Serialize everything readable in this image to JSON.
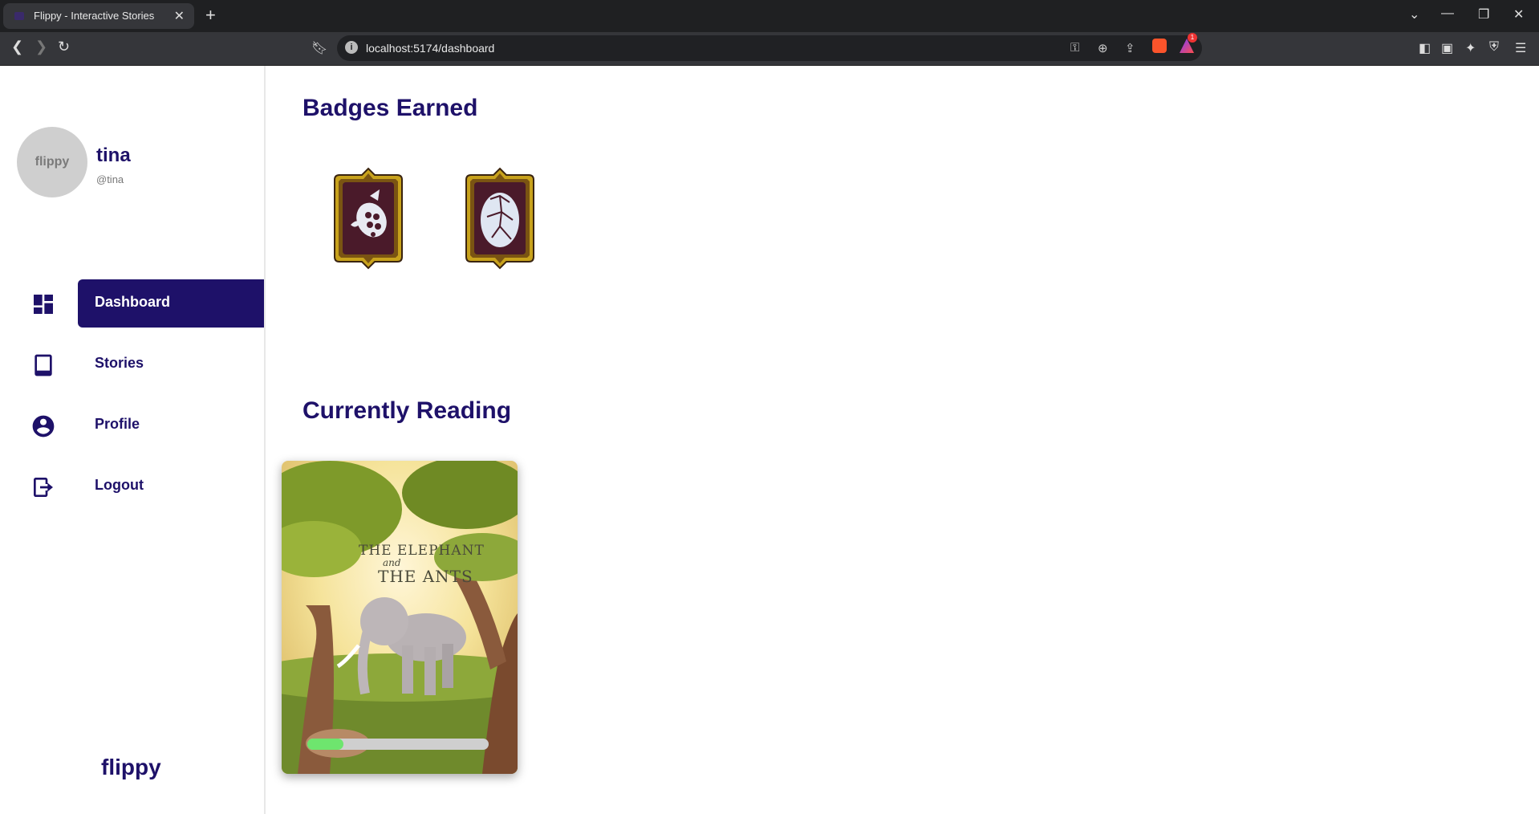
{
  "browser": {
    "tab_title": "Flippy - Interactive Stories",
    "url": "localhost:5174/dashboard",
    "notification_count": "1"
  },
  "sidebar": {
    "avatar_text": "flippy",
    "user_name": "tina",
    "user_handle": "@tina",
    "items": [
      {
        "label": "Dashboard",
        "icon": "dashboard-icon",
        "active": true
      },
      {
        "label": "Stories",
        "icon": "book-icon",
        "active": false
      },
      {
        "label": "Profile",
        "icon": "account-circle-icon",
        "active": false
      },
      {
        "label": "Logout",
        "icon": "logout-icon",
        "active": false
      }
    ],
    "brand": "flippy"
  },
  "main": {
    "badges_heading": "Badges Earned",
    "badges": [
      {
        "icon": "turtle-badge-icon"
      },
      {
        "icon": "egg-badge-icon"
      }
    ],
    "reading_heading": "Currently Reading",
    "current_book": {
      "cover_title_1": "THE ELEPHANT",
      "cover_title_2": "and",
      "cover_title_3": "THE ANTS",
      "progress": 0.2
    }
  },
  "colors": {
    "primary": "#1e1169",
    "progress": "#6ee56e",
    "badge_frame": "#c8a21c",
    "badge_inner": "#4a1a2a"
  }
}
